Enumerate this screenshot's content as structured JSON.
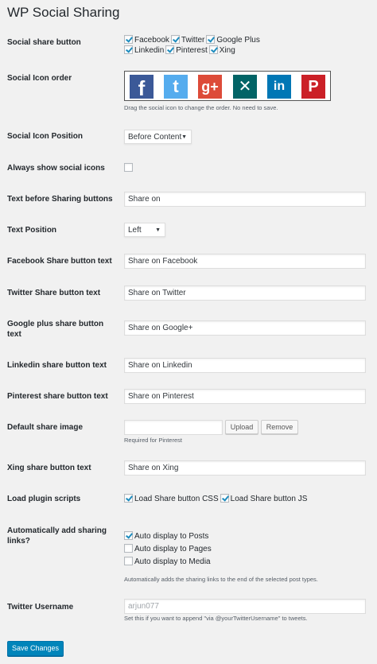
{
  "page": {
    "title": "WP Social Sharing"
  },
  "social_share_button": {
    "label": "Social share button",
    "options": [
      {
        "label": "Facebook",
        "checked": true
      },
      {
        "label": "Twitter",
        "checked": true
      },
      {
        "label": "Google Plus",
        "checked": true
      },
      {
        "label": "Linkedin",
        "checked": true
      },
      {
        "label": "Pinterest",
        "checked": true
      },
      {
        "label": "Xing",
        "checked": true
      }
    ]
  },
  "icon_order": {
    "label": "Social Icon order",
    "icons": [
      {
        "name": "facebook-icon",
        "glyph": "f",
        "color": "#3b5998"
      },
      {
        "name": "twitter-icon",
        "glyph": "t",
        "color": "#55acee"
      },
      {
        "name": "google-plus-icon",
        "glyph": "g+",
        "color": "#dd4b39"
      },
      {
        "name": "xing-icon",
        "glyph": "✕",
        "color": "#026466"
      },
      {
        "name": "linkedin-icon",
        "glyph": "in",
        "color": "#0077b5"
      },
      {
        "name": "pinterest-icon",
        "glyph": "P",
        "color": "#cb2027"
      }
    ],
    "description": "Drag the social icon to change the order. No need to save."
  },
  "icon_position": {
    "label": "Social Icon Position",
    "value": "Before Content"
  },
  "always_show": {
    "label": "Always show social icons",
    "checked": false
  },
  "text_before": {
    "label": "Text before Sharing buttons",
    "value": "Share on"
  },
  "text_position": {
    "label": "Text Position",
    "value": "Left"
  },
  "facebook_text": {
    "label": "Facebook Share button text",
    "value": "Share on Facebook"
  },
  "twitter_text": {
    "label": "Twitter Share button text",
    "value": "Share on Twitter"
  },
  "googleplus_text": {
    "label": "Google plus share button text",
    "value": "Share on Google+"
  },
  "linkedin_text": {
    "label": "Linkedin share button text",
    "value": "Share on Linkedin"
  },
  "pinterest_text": {
    "label": "Pinterest share button text",
    "value": "Share on Pinterest"
  },
  "default_image": {
    "label": "Default share image",
    "value": "",
    "upload_label": "Upload",
    "remove_label": "Remove",
    "description": "Required for Pinterest"
  },
  "xing_text": {
    "label": "Xing share button text",
    "value": "Share on Xing"
  },
  "plugin_scripts": {
    "label": "Load plugin scripts",
    "options": [
      {
        "label": "Load Share button CSS",
        "checked": true
      },
      {
        "label": "Load Share button JS",
        "checked": true
      }
    ]
  },
  "auto_add": {
    "label": "Automatically add sharing links?",
    "options": [
      {
        "label": "Auto display to Posts",
        "checked": true
      },
      {
        "label": "Auto display to Pages",
        "checked": false
      },
      {
        "label": "Auto display to Media",
        "checked": false
      }
    ],
    "description": "Automatically adds the sharing links to the end of the selected post types."
  },
  "twitter_username": {
    "label": "Twitter Username",
    "placeholder": "arjun077",
    "description": "Set this if you want to append \"via @yourTwitterUsername\" to tweets."
  },
  "save": {
    "label": "Save Changes"
  }
}
